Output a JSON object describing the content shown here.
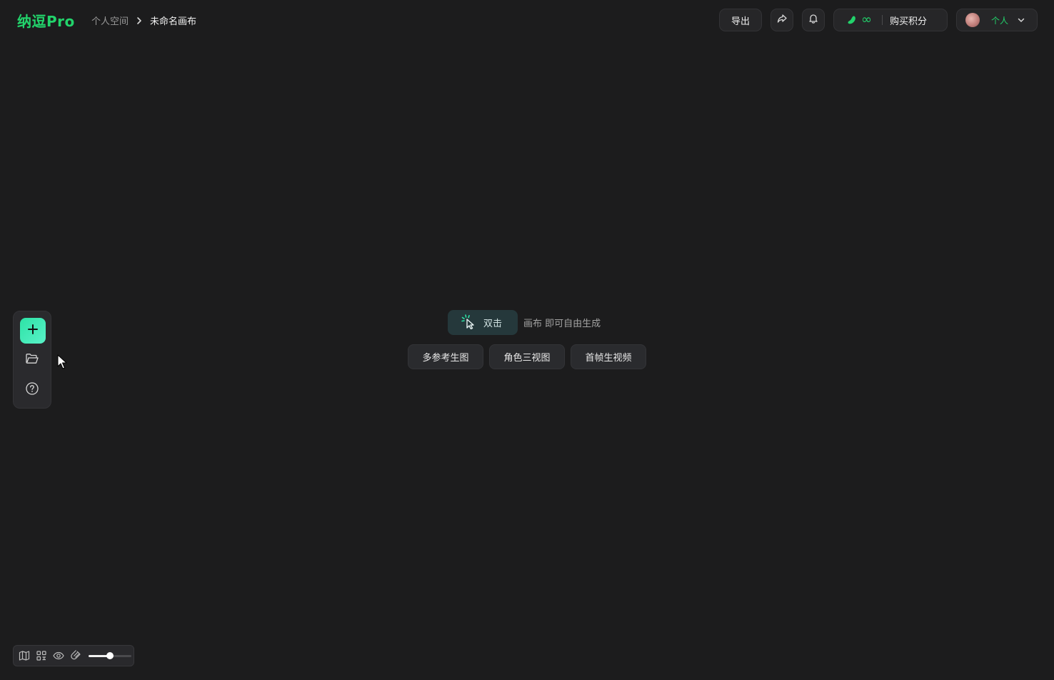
{
  "colors": {
    "accent": "#22d36b",
    "add_gradient_start": "#2de3a6",
    "add_gradient_end": "#59f1c8",
    "background": "#1c1c1d"
  },
  "header": {
    "logo": "纳逗Pro",
    "breadcrumb": {
      "parent": "个人空间",
      "current": "未命名画布"
    },
    "export_label": "导出",
    "share_icon": "share-icon",
    "bell_icon": "bell-icon",
    "credits": {
      "bean_icon": "bean-icon",
      "amount": "∞",
      "buy_label": "购买积分"
    },
    "account": {
      "label": "个人",
      "chevron_icon": "chevron-down-icon"
    }
  },
  "left_toolbar": {
    "items": [
      {
        "icon": "plus-icon",
        "name": "add"
      },
      {
        "icon": "folder-icon",
        "name": "open-folder"
      },
      {
        "icon": "help-icon",
        "name": "help"
      }
    ]
  },
  "hint": {
    "chip_label": "双击",
    "text": "画布 即可自由生成"
  },
  "quick_actions": [
    "多参考生图",
    "角色三视图",
    "首帧生视频"
  ],
  "bottom_bar": {
    "icons": [
      "map-icon",
      "grid-icon",
      "eye-icon",
      "magnet-icon"
    ],
    "zoom_fraction": 0.5
  }
}
